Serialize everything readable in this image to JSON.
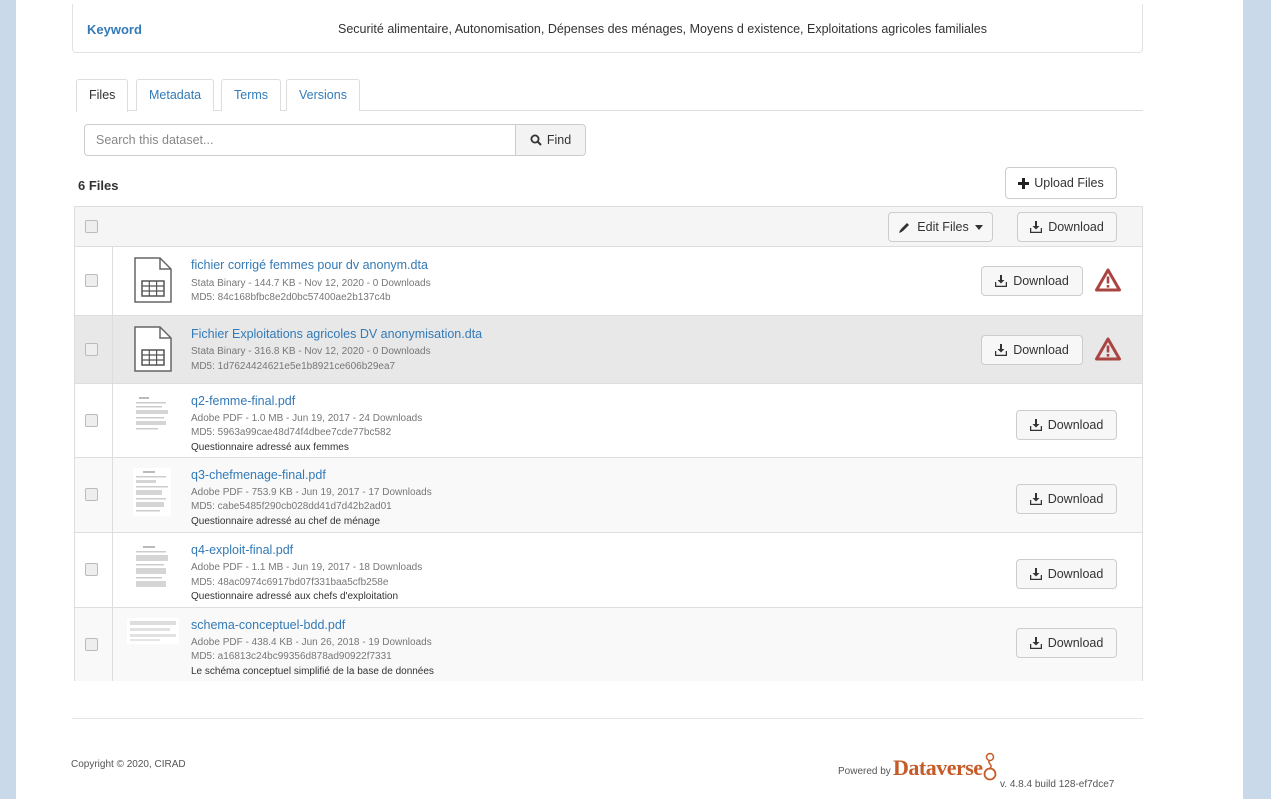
{
  "keyword": {
    "label": "Keyword",
    "value": "Securité alimentaire, Autonomisation, Dépenses des ménages, Moyens d existence, Exploitations agricoles familiales"
  },
  "tabs": [
    {
      "label": "Files",
      "active": true
    },
    {
      "label": "Metadata",
      "active": false
    },
    {
      "label": "Terms",
      "active": false
    },
    {
      "label": "Versions",
      "active": false
    }
  ],
  "search": {
    "placeholder": "Search this dataset...",
    "find_label": "Find"
  },
  "files_count": "6 Files",
  "upload_label": "Upload Files",
  "table_header": {
    "edit_label": "Edit Files",
    "download_label": "Download"
  },
  "files": [
    {
      "name": "fichier corrigé femmes pour dv anonym.dta",
      "meta": "Stata Binary - 144.7 KB - Nov 12, 2020 - 0 Downloads",
      "md5": "MD5: 84c168bfbc8e2d0bc57400ae2b137c4b",
      "description": "",
      "download_label": "Download",
      "type": "tabular",
      "warning": true
    },
    {
      "name": "Fichier Exploitations agricoles DV anonymisation.dta",
      "meta": "Stata Binary - 316.8 KB - Nov 12, 2020 - 0 Downloads",
      "md5": "MD5: 1d7624424621e5e1b8921ce606b29ea7",
      "description": "",
      "download_label": "Download",
      "type": "tabular",
      "warning": true
    },
    {
      "name": "q2-femme-final.pdf",
      "meta": "Adobe PDF - 1.0 MB - Jun 19, 2017 - 24 Downloads",
      "md5": "MD5: 5963a99cae48d74f4dbee7cde77bc582",
      "description": "Questionnaire adressé aux femmes",
      "download_label": "Download",
      "type": "pdf",
      "warning": false
    },
    {
      "name": "q3-chefmenage-final.pdf",
      "meta": "Adobe PDF - 753.9 KB - Jun 19, 2017 - 17 Downloads",
      "md5": "MD5: cabe5485f290cb028dd41d7d42b2ad01",
      "description": "Questionnaire adressé au chef de ménage",
      "download_label": "Download",
      "type": "pdf",
      "warning": false
    },
    {
      "name": "q4-exploit-final.pdf",
      "meta": "Adobe PDF - 1.1 MB - Jun 19, 2017 - 18 Downloads",
      "md5": "MD5: 48ac0974c6917bd07f331baa5cfb258e",
      "description": "Questionnaire adressé aux chefs d'exploitation",
      "download_label": "Download",
      "type": "pdf",
      "warning": false
    },
    {
      "name": "schema-conceptuel-bdd.pdf",
      "meta": "Adobe PDF - 438.4 KB - Jun 26, 2018 - 19 Downloads",
      "md5": "MD5: a16813c24bc99356d878ad90922f7331",
      "description": "Le schéma conceptuel simplifié de la base de données",
      "download_label": "Download",
      "type": "pdf-wide",
      "warning": false
    }
  ],
  "footer": {
    "copyright": "Copyright © 2020, CIRAD",
    "powered_by": "Powered by",
    "logo_text": "Dataverse",
    "version": "v. 4.8.4 build 128-ef7dce7"
  },
  "colors": {
    "link": "#337ab7",
    "warning": "#a94442",
    "logo": "#c55b28",
    "background": "#c9d9ea"
  }
}
